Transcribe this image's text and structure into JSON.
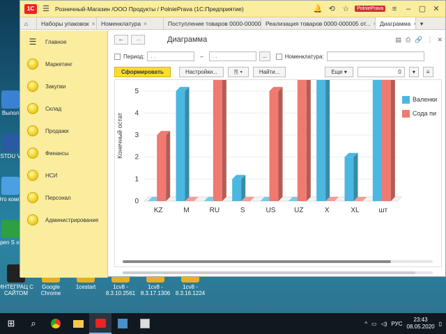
{
  "desktop": {
    "icons": [
      {
        "label": "Выпол",
        "color": "#3a82d0"
      },
      {
        "label": "STDU V",
        "color": "#2a5aa0"
      },
      {
        "label": "Это компь",
        "color": "#4aa0e0"
      },
      {
        "label": "Open S x64",
        "color": "#2da042"
      },
      {
        "label": "ИНТЕГРАЦ С САЙТОМ",
        "color": "#222222"
      },
      {
        "label": "Google Chrome",
        "color": "#e8b020"
      },
      {
        "label": "1cestart",
        "color": "#e8b020"
      },
      {
        "label": "1cv8 - 8.3.10.2561",
        "color": "#e8b020"
      },
      {
        "label": "1cv8 - 8.3.17.1306",
        "color": "#e8b020"
      },
      {
        "label": "1cv8 - 8.3.16.1224",
        "color": "#e8b020"
      }
    ]
  },
  "window": {
    "title": "Розничный-Магазин /ООО Продукты / PolniePrava  (1С:Предприятие)",
    "user": "PolniePrava",
    "tabs": [
      {
        "label": "Наборы упаковок"
      },
      {
        "label": "Номенклатура"
      },
      {
        "label": "Поступление товаров 0000-000002 о..."
      },
      {
        "label": "Реализация товаров 0000-000005 от..."
      },
      {
        "label": "Диаграмма"
      }
    ]
  },
  "sidebar": {
    "items": [
      {
        "label": "Главное",
        "icon": "menu-icon"
      },
      {
        "label": "Маркетинг"
      },
      {
        "label": "Закупки"
      },
      {
        "label": "Склад"
      },
      {
        "label": "Продажи"
      },
      {
        "label": "Финансы"
      },
      {
        "label": "НСИ"
      },
      {
        "label": "Персонал"
      },
      {
        "label": "Администрирование"
      }
    ]
  },
  "form": {
    "title": "Диаграмма",
    "period_label": "Период:",
    "date_from": ". .",
    "date_to": ". .",
    "dash": "–",
    "ellipsis": "...",
    "nomen_label": "Номенклатура:",
    "generate": "Сформировать",
    "settings": "Настройки...",
    "find": "Найти...",
    "more": "Еще",
    "num_value": "0"
  },
  "chart_data": {
    "type": "bar",
    "ylabel": "Конечный остат",
    "ylim": [
      0,
      5.5
    ],
    "yticks": [
      0,
      1,
      2,
      3,
      4,
      5
    ],
    "categories": [
      "KZ",
      "M",
      "RU",
      "S",
      "US",
      "UZ",
      "X",
      "XL",
      "шт"
    ],
    "series": [
      {
        "name": "Валенки",
        "color": "#4ab8e0",
        "values": [
          0,
          5,
          0,
          1,
          0,
          0,
          6,
          2,
          6
        ]
      },
      {
        "name": "Сода пи",
        "color": "#f07a70",
        "values": [
          3,
          0,
          6,
          0,
          5,
          6,
          0,
          0,
          6
        ]
      }
    ]
  },
  "taskbar": {
    "lang": "РУС",
    "time": "23:43",
    "date": "08.05.2020"
  }
}
